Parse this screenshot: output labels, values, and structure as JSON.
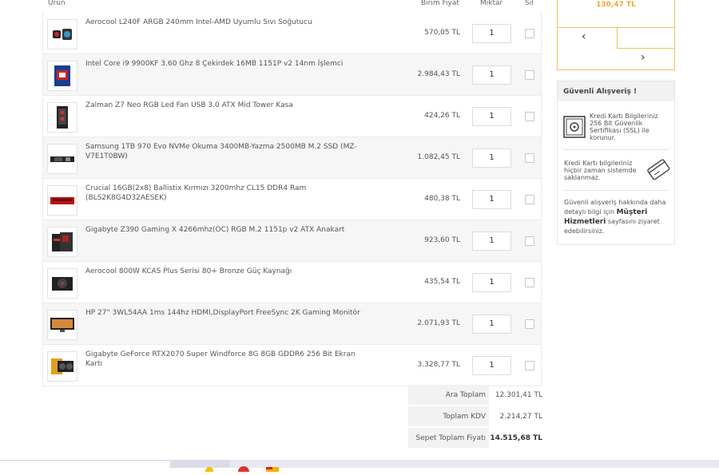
{
  "cart": {
    "headers": {
      "product": "Ürün",
      "unit_price": "Birim Fiyat",
      "quantity": "Miktar",
      "delete": "Sil"
    },
    "items": [
      {
        "name": "Aerocool L240F ARGB 240mm Intel-AMD Uyumlu Sıvı Soğutucu",
        "price": "570,05 TL",
        "qty": "1",
        "icon": "liquid-cooler-icon"
      },
      {
        "name": "Intel Core i9 9900KF 3.60 Ghz 8 Çekirdek 16MB 1151P v2 14nm İşlemci",
        "price": "2.984,43 TL",
        "qty": "1",
        "icon": "cpu-box-icon"
      },
      {
        "name": "Zalman Z7 Neo RGB Led Fan USB 3.0 ATX Mid Tower Kasa",
        "price": "424,26 TL",
        "qty": "1",
        "icon": "pc-case-icon"
      },
      {
        "name": "Samsung 1TB 970 Evo NVMe Okuma 3400MB-Yazma 2500MB M.2 SSD (MZ-V7E1T0BW)",
        "price": "1.082,45 TL",
        "qty": "1",
        "icon": "ssd-icon"
      },
      {
        "name": "Crucial 16GB(2x8) Ballistix Kırmızı 3200mhz CL15 DDR4 Ram (BLS2K8G4D32AESEK)",
        "price": "480,38 TL",
        "qty": "1",
        "icon": "ram-icon"
      },
      {
        "name": "Gigabyte Z390 Gaming X 4266mhz(OC) RGB M.2 1151p v2 ATX Anakart",
        "price": "923,60 TL",
        "qty": "1",
        "icon": "motherboard-icon"
      },
      {
        "name": "Aerocool 800W KCAS Plus Serisi 80+ Bronze Güç Kaynağı",
        "price": "435,54 TL",
        "qty": "1",
        "icon": "power-supply-icon"
      },
      {
        "name": "HP 27\" 3WL54AA 1ms 144hz HDMI,DisplayPort FreeSync 2K Gaming Monitör",
        "price": "2.071,93 TL",
        "qty": "1",
        "icon": "monitor-icon"
      },
      {
        "name": "Gigabyte GeForce RTX2070 Super Windforce 8G 8GB GDDR6 256 Bit Ekran Kartı",
        "price": "3.328,77 TL",
        "qty": "1",
        "icon": "graphics-card-icon"
      }
    ]
  },
  "totals": {
    "subtotal_label": "Ara Toplam",
    "subtotal_value": "12.301,41 TL",
    "vat_label": "Toplam KDV",
    "vat_value": "2.214,27 TL",
    "total_label": "Sepet Toplam Fiyatı",
    "total_value": "14.515,68 TL"
  },
  "sidebar": {
    "promo": {
      "price": "130,47 TL",
      "prev_arrow": "‹",
      "next_arrow": "›"
    },
    "secure": {
      "title": "Güvenli Alışveriş !",
      "ssl_text": "Kredi Kartı Bilgileriniz 256 Bit Güvenlik Sertifikası (SSL) ile korunur.",
      "card_text": "Kredi Kartı bilgileriniz hiçbir zaman sistemde saklanmaz.",
      "help_prefix": "Güvenli alışveriş hakkında daha detaylı bilgi için ",
      "help_link": "Müşteri Hizmetleri",
      "help_suffix": " sayfasını ziyaret edebilirsiniz."
    }
  },
  "colors": {
    "accent": "#f0a830",
    "row_alt": "#f6f6f6"
  }
}
